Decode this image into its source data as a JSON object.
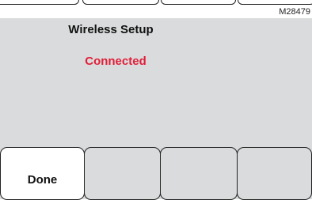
{
  "figure_id": "M28479",
  "screen": {
    "title": "Wireless Setup",
    "status": "Connected",
    "status_color": "#e0203a",
    "background_color": "#dadbdc"
  },
  "buttons": [
    {
      "label": "Done",
      "active": true
    },
    {
      "label": "",
      "active": false
    },
    {
      "label": "",
      "active": false
    },
    {
      "label": "",
      "active": false
    }
  ]
}
